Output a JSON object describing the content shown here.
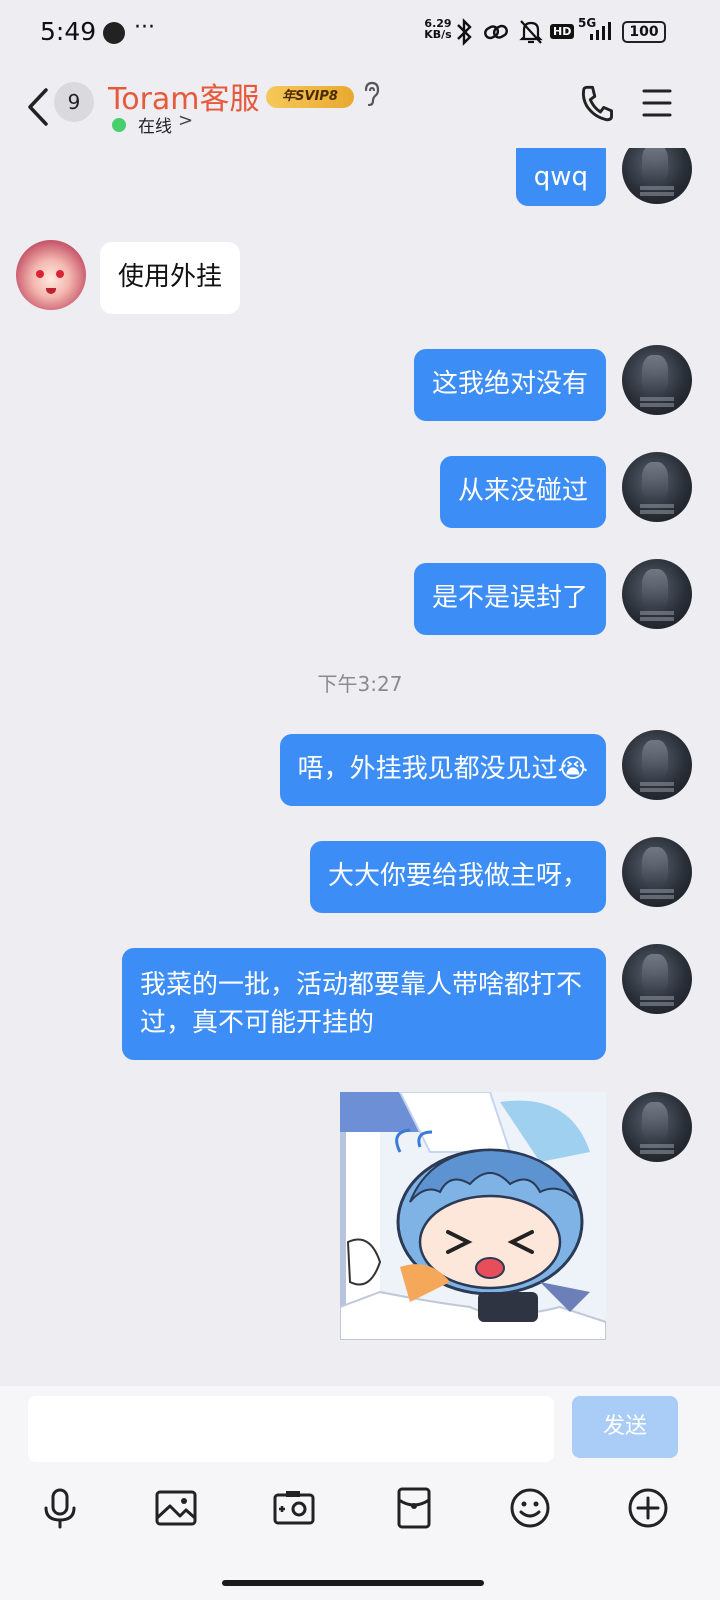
{
  "status_bar": {
    "time": "5:49",
    "more": "···",
    "net_speed_value": "6.29",
    "net_speed_unit": "KB/s",
    "hd": "HD",
    "network": "5G",
    "battery": "100"
  },
  "header": {
    "unread_count": "9",
    "contact_name": "Toram客服",
    "svip_badge": "年SVIP8",
    "online_status": "在线",
    "online_chevron": ">"
  },
  "messages": [
    {
      "side": "self",
      "text": "qwq"
    },
    {
      "side": "other",
      "text": "使用外挂"
    },
    {
      "side": "self",
      "text": "这我绝对没有"
    },
    {
      "side": "self",
      "text": "从来没碰过"
    },
    {
      "side": "self",
      "text": "是不是误封了"
    },
    {
      "side": "self",
      "text": "唔，外挂我见都没见过😭"
    },
    {
      "side": "self",
      "text": "大大你要给我做主呀，"
    },
    {
      "side": "self",
      "text": "我菜的一批，活动都要靠人带啥都打不过，真不可能开挂的"
    },
    {
      "side": "self",
      "type": "sticker",
      "text": ""
    }
  ],
  "time_separator": "下午3:27",
  "composer": {
    "send_label": "发送",
    "placeholder": ""
  },
  "toolbar": [
    "mic-icon",
    "photo-icon",
    "camera-icon",
    "red-packet-icon",
    "emoji-icon",
    "plus-icon"
  ],
  "colors": {
    "self_bubble": "#3c8df5",
    "other_bubble": "#ffffff",
    "name": "#e8593c",
    "online": "#45d06b",
    "send_disabled": "#a9cdf6"
  }
}
